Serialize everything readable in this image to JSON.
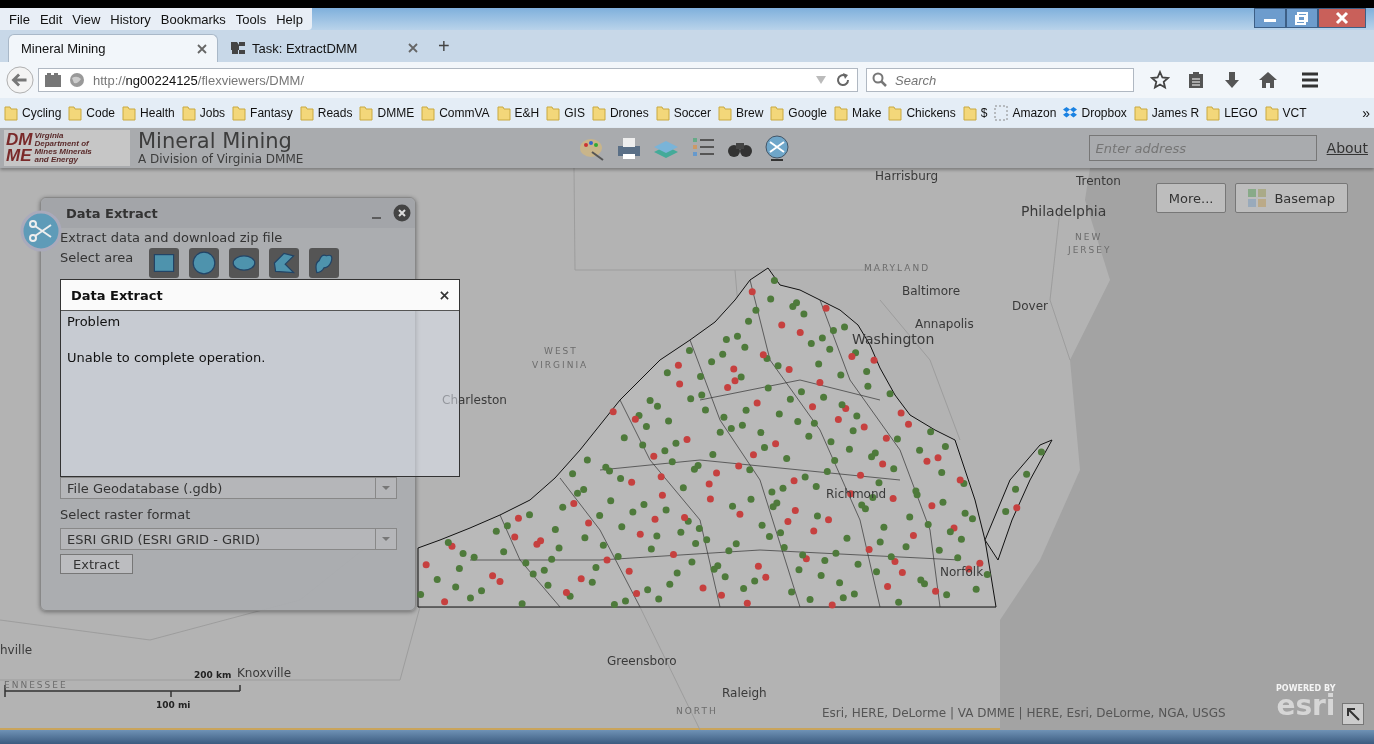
{
  "menu_bar": [
    "File",
    "Edit",
    "View",
    "History",
    "Bookmarks",
    "Tools",
    "Help"
  ],
  "tabs": [
    {
      "label": "Mineral Mining",
      "selected": true,
      "kind": "plain"
    },
    {
      "label": "Task: ExtractDMM",
      "selected": false,
      "kind": "logo"
    }
  ],
  "new_tab": "+",
  "address_bar": {
    "scheme": "http://",
    "host": "ng00224125",
    "path": "/flexviewers/DMM/"
  },
  "search": {
    "placeholder": "Search"
  },
  "bookmarks": [
    {
      "label": "Cycling",
      "kind": "folder"
    },
    {
      "label": "Code",
      "kind": "folder"
    },
    {
      "label": "Health",
      "kind": "folder"
    },
    {
      "label": "Jobs",
      "kind": "folder"
    },
    {
      "label": "Fantasy",
      "kind": "folder"
    },
    {
      "label": "Reads",
      "kind": "folder"
    },
    {
      "label": "DMME",
      "kind": "folder"
    },
    {
      "label": "CommVA",
      "kind": "folder"
    },
    {
      "label": "E&H",
      "kind": "folder"
    },
    {
      "label": "GIS",
      "kind": "folder"
    },
    {
      "label": "Drones",
      "kind": "folder"
    },
    {
      "label": "Soccer",
      "kind": "folder"
    },
    {
      "label": "Brew",
      "kind": "folder"
    },
    {
      "label": "Google",
      "kind": "folder"
    },
    {
      "label": "Make",
      "kind": "folder"
    },
    {
      "label": "Chickens",
      "kind": "folder"
    },
    {
      "label": "$",
      "kind": "folder"
    },
    {
      "label": "Amazon",
      "kind": "page"
    },
    {
      "label": "Dropbox",
      "kind": "dropbox"
    },
    {
      "label": "James R",
      "kind": "folder"
    },
    {
      "label": "LEGO",
      "kind": "folder"
    },
    {
      "label": "VCT",
      "kind": "folder"
    }
  ],
  "bookmarks_overflow": "»",
  "app": {
    "logo_letters": [
      "DM",
      "ME"
    ],
    "logo_text": "Virginia Department of Mines Minerals and Energy",
    "title": "Mineral Mining",
    "subtitle": "A Division of Virginia DMME",
    "address_placeholder": "Enter address",
    "about": "About"
  },
  "map": {
    "labels": [
      {
        "text": "Harrisburg",
        "kind": "city"
      },
      {
        "text": "Trenton",
        "kind": "city"
      },
      {
        "text": "Philadelphia",
        "kind": "major"
      },
      {
        "text": "NEW",
        "kind": "region"
      },
      {
        "text": "JERSEY",
        "kind": "region"
      },
      {
        "text": "MARYLAND",
        "kind": "region"
      },
      {
        "text": "Baltimore",
        "kind": "city"
      },
      {
        "text": "Dover",
        "kind": "city"
      },
      {
        "text": "Annapolis",
        "kind": "city"
      },
      {
        "text": "Washington",
        "kind": "major"
      },
      {
        "text": "WEST",
        "kind": "region"
      },
      {
        "text": "VIRGINIA",
        "kind": "region"
      },
      {
        "text": "Charleston",
        "kind": "city"
      },
      {
        "text": "Richmond",
        "kind": "city"
      },
      {
        "text": "Norfolk",
        "kind": "city"
      },
      {
        "text": "hville",
        "kind": "city"
      },
      {
        "text": "Knoxville",
        "kind": "city"
      },
      {
        "text": "ENNESSEE",
        "kind": "region"
      },
      {
        "text": "Greensboro",
        "kind": "city"
      },
      {
        "text": "Raleigh",
        "kind": "city"
      },
      {
        "text": "NORTH",
        "kind": "region"
      }
    ],
    "buttons": [
      "More...",
      "Basemap"
    ],
    "scale": {
      "km": "200 km",
      "mi": "100 mi"
    },
    "attribution": "Esri, HERE, DeLorme | VA DMME | HERE, Esri, DeLorme, NGA, USGS",
    "esri": {
      "powered": "POWERED BY",
      "brand": "esri"
    }
  },
  "panel": {
    "title": "Data Extract",
    "description": "Extract data and download zip file",
    "area_label": "Select area",
    "area_tools": [
      {
        "kind": "rectangle"
      },
      {
        "kind": "circle"
      },
      {
        "kind": "ellipse"
      },
      {
        "kind": "polygon"
      },
      {
        "kind": "freehand"
      }
    ],
    "file_format": "File Geodatabase (.gdb)",
    "raster_label": "Select raster format",
    "raster_format": "ESRI GRID (ESRI GRID - GRID)",
    "extract_button": "Extract"
  },
  "dialog": {
    "title": "Data Extract",
    "heading": "Problem",
    "message": "Unable to complete operation."
  }
}
